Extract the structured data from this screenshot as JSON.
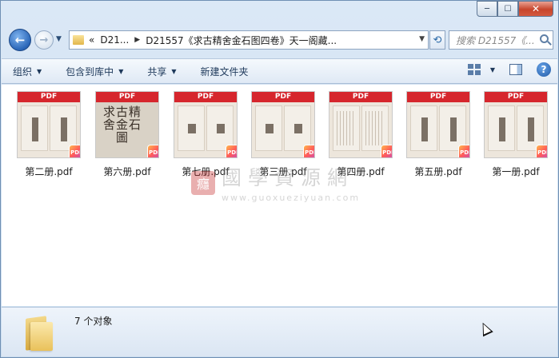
{
  "window_controls": {
    "minimize": "─",
    "maximize": "☐",
    "close": "✕"
  },
  "nav": {
    "back_glyph": "←",
    "forward_glyph": "→",
    "dropdown_glyph": "▼",
    "breadcrumb": {
      "overflow": "«",
      "segments": [
        "D21...",
        "D21557《求古精舍金石图四卷》天一阁藏..."
      ]
    },
    "refresh_glyph": "⟲",
    "search_placeholder": "搜索 D21557《..."
  },
  "toolbar": {
    "items": [
      {
        "label": "组织",
        "has_dropdown": true
      },
      {
        "label": "包含到库中",
        "has_dropdown": true
      },
      {
        "label": "共享",
        "has_dropdown": true
      },
      {
        "label": "新建文件夹",
        "has_dropdown": false
      }
    ],
    "help_glyph": "?"
  },
  "files": [
    {
      "name": "第二册.pdf",
      "thumb_style": "spread-blocks",
      "band": "PDF"
    },
    {
      "name": "第六册.pdf",
      "thumb_style": "cover",
      "band": "PDF",
      "cover_text": "求古精舍金石圖"
    },
    {
      "name": "第七册.pdf",
      "thumb_style": "spread-seals",
      "band": "PDF"
    },
    {
      "name": "第三册.pdf",
      "thumb_style": "spread-seals",
      "band": "PDF"
    },
    {
      "name": "第四册.pdf",
      "thumb_style": "spread-text",
      "band": "PDF"
    },
    {
      "name": "第五册.pdf",
      "thumb_style": "spread-blocks",
      "band": "PDF"
    },
    {
      "name": "第一册.pdf",
      "thumb_style": "spread-blocks",
      "band": "PDF"
    }
  ],
  "badge_label": "PDF",
  "watermark": {
    "title": "國學資源網",
    "url": "www.guoxueziyuan.com",
    "seal": "癮"
  },
  "status": {
    "text": "7 个对象"
  },
  "colors": {
    "pdf_band": "#d6262d",
    "toolbar_text": "#1e395b"
  }
}
